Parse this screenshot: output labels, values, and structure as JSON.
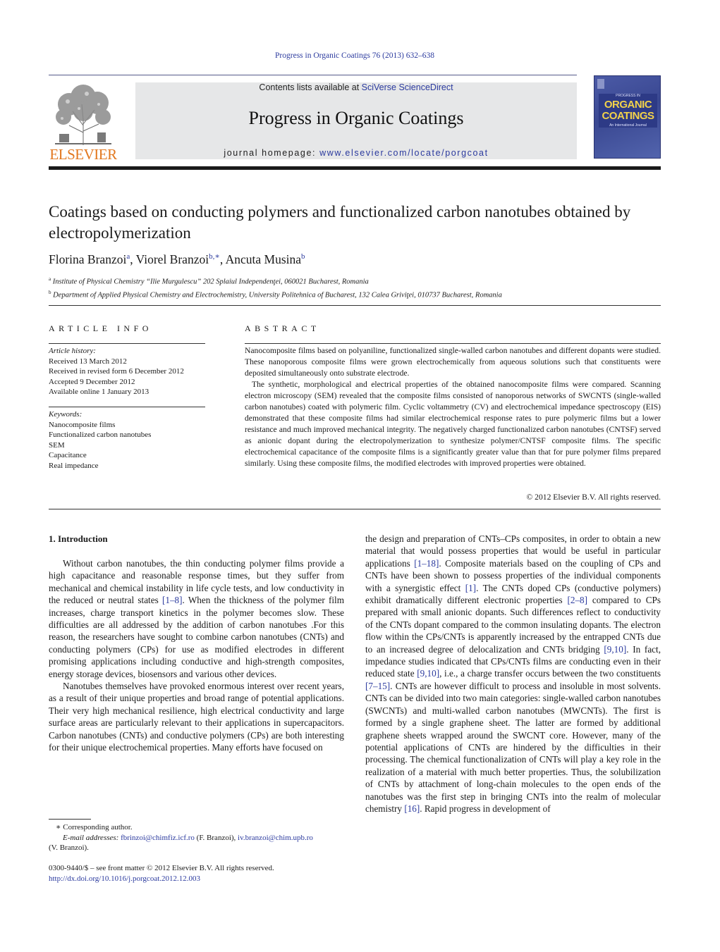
{
  "header": {
    "citation": "Progress in Organic Coatings 76 (2013) 632–638",
    "contents_prefix": "Contents lists available at ",
    "contents_link": "SciVerse ScienceDirect",
    "journal_title": "Progress in Organic Coatings",
    "homepage_prefix": "journal homepage: ",
    "homepage_link": "www.elsevier.com/locate/porgcoat",
    "publisher_logo_text": "ELSEVIER",
    "cover": {
      "small_line": "PROGRESS IN",
      "title_line1": "ORGANIC",
      "title_line2": "COATINGS",
      "subtitle": "An International Journal"
    }
  },
  "article": {
    "title": "Coatings based on conducting polymers and functionalized carbon nanotubes obtained by electropolymerization",
    "authors": [
      {
        "name": "Florina Branzoi",
        "sup": "a",
        "sep": ", "
      },
      {
        "name": "Viorel Branzoi",
        "sup": "b,∗",
        "sep": ", "
      },
      {
        "name": "Ancuta Musina",
        "sup": "b",
        "sep": ""
      }
    ],
    "affiliations": [
      {
        "mark": "a",
        "text": "Institute of Physical Chemistry “Ilie Murgulescu” 202 Splaiul Independenţei, 060021 Bucharest, Romania"
      },
      {
        "mark": "b",
        "text": "Department of Applied Physical Chemistry and Electrochemistry, University Politehnica of Bucharest, 132 Calea Griviţei, 010737 Bucharest, Romania"
      }
    ]
  },
  "article_info": {
    "heading": "ARTICLE INFO",
    "history_label": "Article history:",
    "history": [
      "Received 13 March 2012",
      "Received in revised form 6 December 2012",
      "Accepted 9 December 2012",
      "Available online 1 January 2013"
    ],
    "keywords_label": "Keywords:",
    "keywords": [
      "Nanocomposite films",
      "Functionalized carbon nanotubes",
      "SEM",
      "Capacitance",
      "Real impedance"
    ]
  },
  "abstract": {
    "heading": "ABSTRACT",
    "paragraphs": [
      "Nanocomposite films based on polyaniline, functionalized single-walled carbon nanotubes and different dopants were studied. These nanoporous composite films were grown electrochemically from aqueous solutions such that constituents were deposited simultaneously onto substrate electrode.",
      "The synthetic, morphological and electrical properties of the obtained nanocomposite films were compared. Scanning electron microscopy (SEM) revealed that the composite films consisted of nanoporous networks of SWCNTS (single-walled carbon nanotubes) coated with polymeric film. Cyclic voltammetry (CV) and electrochemical impedance spectroscopy (EIS) demonstrated that these composite films had similar electrochemical response rates to pure polymeric films but a lower resistance and much improved mechanical integrity. The negatively charged functionalized carbon nanotubes (CNTSF) served as anionic dopant during the electropolymerization to synthesize polymer/CNTSF composite films. The specific electrochemical capacitance of the composite films is a significantly greater value than that for pure polymer films prepared similarly. Using these composite films, the modified electrodes with improved properties were obtained."
    ],
    "copyright": "© 2012 Elsevier B.V. All rights reserved."
  },
  "body": {
    "section_heading": "1.  Introduction",
    "left_paragraphs": [
      [
        {
          "t": "Without carbon nanotubes, the thin conducting polymer films provide a high capacitance and reasonable response times, but they suffer from mechanical and chemical instability in life cycle tests, and low conductivity in the reduced or neutral states "
        },
        {
          "ref": "[1–8]"
        },
        {
          "t": ". When the thickness of the polymer film increases, charge transport kinetics in the polymer becomes slow. These difficulties are all addressed by the addition of carbon nanotubes .For this reason, the researchers have sought to combine carbon nanotubes (CNTs) and conducting polymers (CPs) for use as modified electrodes in different promising applications including conductive and high-strength composites, energy storage devices, biosensors and various other devices."
        }
      ],
      [
        {
          "t": "Nanotubes themselves have provoked enormous interest over recent years, as a result of their unique properties and broad range of potential applications. Their very high mechanical resilience, high electrical conductivity and large surface areas are particularly relevant to their applications in supercapacitors. Carbon nanotubes (CNTs) and conductive polymers (CPs) are both interesting for their unique electrochemical properties. Many efforts have focused on"
        }
      ]
    ],
    "right_paragraphs": [
      [
        {
          "t": "the design and preparation of CNTs–CPs composites, in order to obtain a new material that would possess properties that would be useful in particular applications "
        },
        {
          "ref": "[1–18]"
        },
        {
          "t": ". Composite materials based on the coupling of CPs and CNTs have been shown to possess properties of the individual components with a synergistic effect "
        },
        {
          "ref": "[1]"
        },
        {
          "t": ". The CNTs doped CPs (conductive polymers) exhibit dramatically different electronic properties "
        },
        {
          "ref": "[2–8]"
        },
        {
          "t": " compared to CPs prepared with small anionic dopants. Such differences reflect to conductivity of the CNTs dopant compared to the common insulating dopants. The electron flow within the CPs/CNTs is apparently increased by the entrapped CNTs due to an increased degree of delocalization and CNTs bridging "
        },
        {
          "ref": "[9,10]"
        },
        {
          "t": ". In fact, impedance studies indicated that CPs/CNTs films are conducting even in their reduced state "
        },
        {
          "ref": "[9,10]"
        },
        {
          "t": ", i.e., a charge transfer occurs between the two constituents "
        },
        {
          "ref": "[7–15]"
        },
        {
          "t": ". CNTs are however difficult to process and insoluble in most solvents. CNTs can be divided into two main categories: single-walled carbon nanotubes (SWCNTs) and multi-walled carbon nanotubes (MWCNTs). The first is formed by a single graphene sheet. The latter are formed by additional graphene sheets wrapped around the SWCNT core. However, many of the potential applications of CNTs are hindered by the difficulties in their processing. The chemical functionalization of CNTs will play a key role in the realization of a material with much better properties. Thus, the solubilization of CNTs by attachment of long-chain molecules to the open ends of the nanotubes was the first step in bringing CNTs into the realm of molecular chemistry "
        },
        {
          "ref": "[16]"
        },
        {
          "t": ". Rapid progress in development of"
        }
      ]
    ]
  },
  "footnotes": {
    "corresponding": "∗  Corresponding author.",
    "email_label": "E-mail addresses:",
    "email1": "fbrinzoi@chimfiz.icf.ro",
    "email1_owner": " (F. Branzoi), ",
    "email2": "iv.branzoi@chim.upb.ro",
    "email2_owner": "(V. Branzoi).",
    "front_matter": "0300-9440/$ – see front matter © 2012 Elsevier B.V. All rights reserved.",
    "doi": "http://dx.doi.org/10.1016/j.porgcoat.2012.12.003"
  }
}
